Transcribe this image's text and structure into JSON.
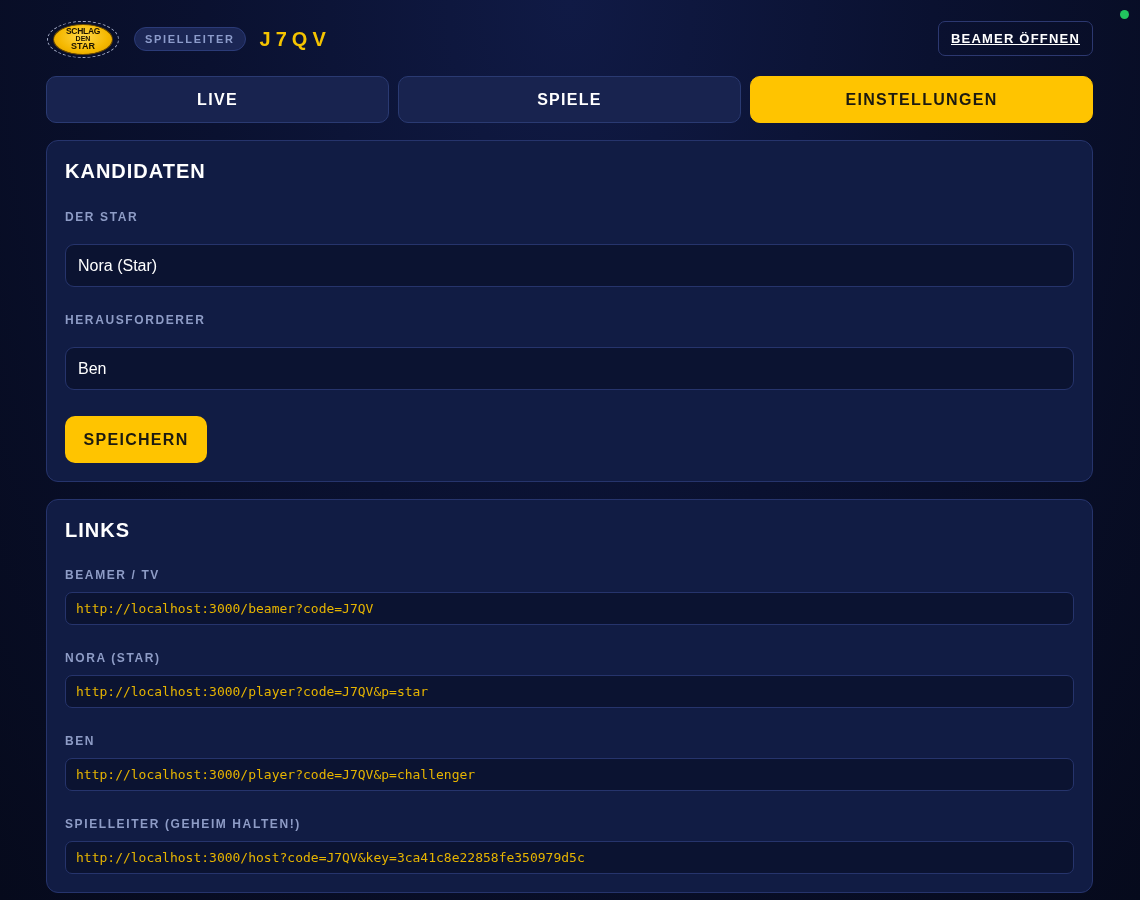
{
  "header": {
    "logo": [
      "SCHLAG",
      "DEN",
      "STAR"
    ],
    "role_badge": "SPIELLEITER",
    "room_code": "J7QV",
    "beamer_button": "BEAMER ÖFFNEN"
  },
  "connection": {
    "online": true
  },
  "tabs": [
    {
      "label": "LIVE",
      "selected": false
    },
    {
      "label": "SPIELE",
      "selected": false
    },
    {
      "label": "EINSTELLUNGEN",
      "selected": true
    }
  ],
  "candidates": {
    "title": "KANDIDATEN",
    "fields": [
      {
        "label": "DER STAR",
        "value": "Nora (Star)"
      },
      {
        "label": "HERAUSFORDERER",
        "value": "Ben"
      }
    ],
    "save_button": "SPEICHERN"
  },
  "links": {
    "title": "LINKS",
    "items": [
      {
        "label": "BEAMER / TV",
        "url": "http://localhost:3000/beamer?code=J7QV"
      },
      {
        "label": "NORA (STAR)",
        "url": "http://localhost:3000/player?code=J7QV&p=star"
      },
      {
        "label": "BEN",
        "url": "http://localhost:3000/player?code=J7QV&p=challenger"
      },
      {
        "label": "SPIELLEITER (GEHEIM HALTEN!)",
        "url": "http://localhost:3000/host?code=J7QV&key=3ca41c8e22858fe350979d5c"
      }
    ]
  }
}
